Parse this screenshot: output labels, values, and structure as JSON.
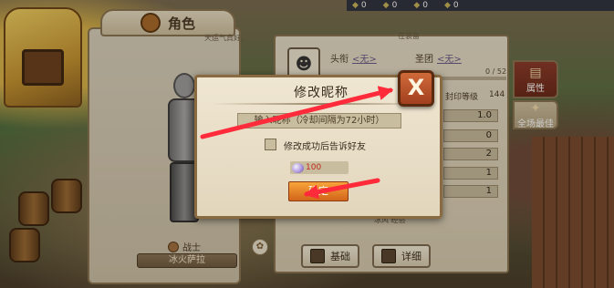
{
  "top_bar": {
    "stat1": "0",
    "stat2": "0",
    "stat3": "0",
    "stat4": "0"
  },
  "character": {
    "tab_title": "角色",
    "header_text": "天运气真好。",
    "class_name": "战士",
    "player_name": "冰火萨拉"
  },
  "stats": {
    "top_text": "在装备",
    "title_label": "头衔",
    "title_value": "<无>",
    "guild_label": "圣团",
    "guild_value": "<无>",
    "progress": "0 / 52",
    "seal_level_label": "封印等级",
    "seal_level_value": "144",
    "values": [
      "1.0",
      "0",
      "2",
      "1",
      "1"
    ],
    "bottom_text": "冰风 经验"
  },
  "bottom_buttons": {
    "basic": "基础",
    "detail": "详细"
  },
  "side_tabs": {
    "attributes": "属性",
    "best": "全场最佳"
  },
  "dialog": {
    "title": "修改昵称",
    "input_placeholder": "输入昵称（冷却间隔为72小时）",
    "notify_label": "修改成功后告诉好友",
    "cost": "100",
    "confirm_label": "确定",
    "close_label": "X"
  },
  "colors": {
    "annotation_arrow": "#ff2a3a",
    "confirm_btn": "#f08a2a",
    "close_btn": "#c0552a"
  }
}
